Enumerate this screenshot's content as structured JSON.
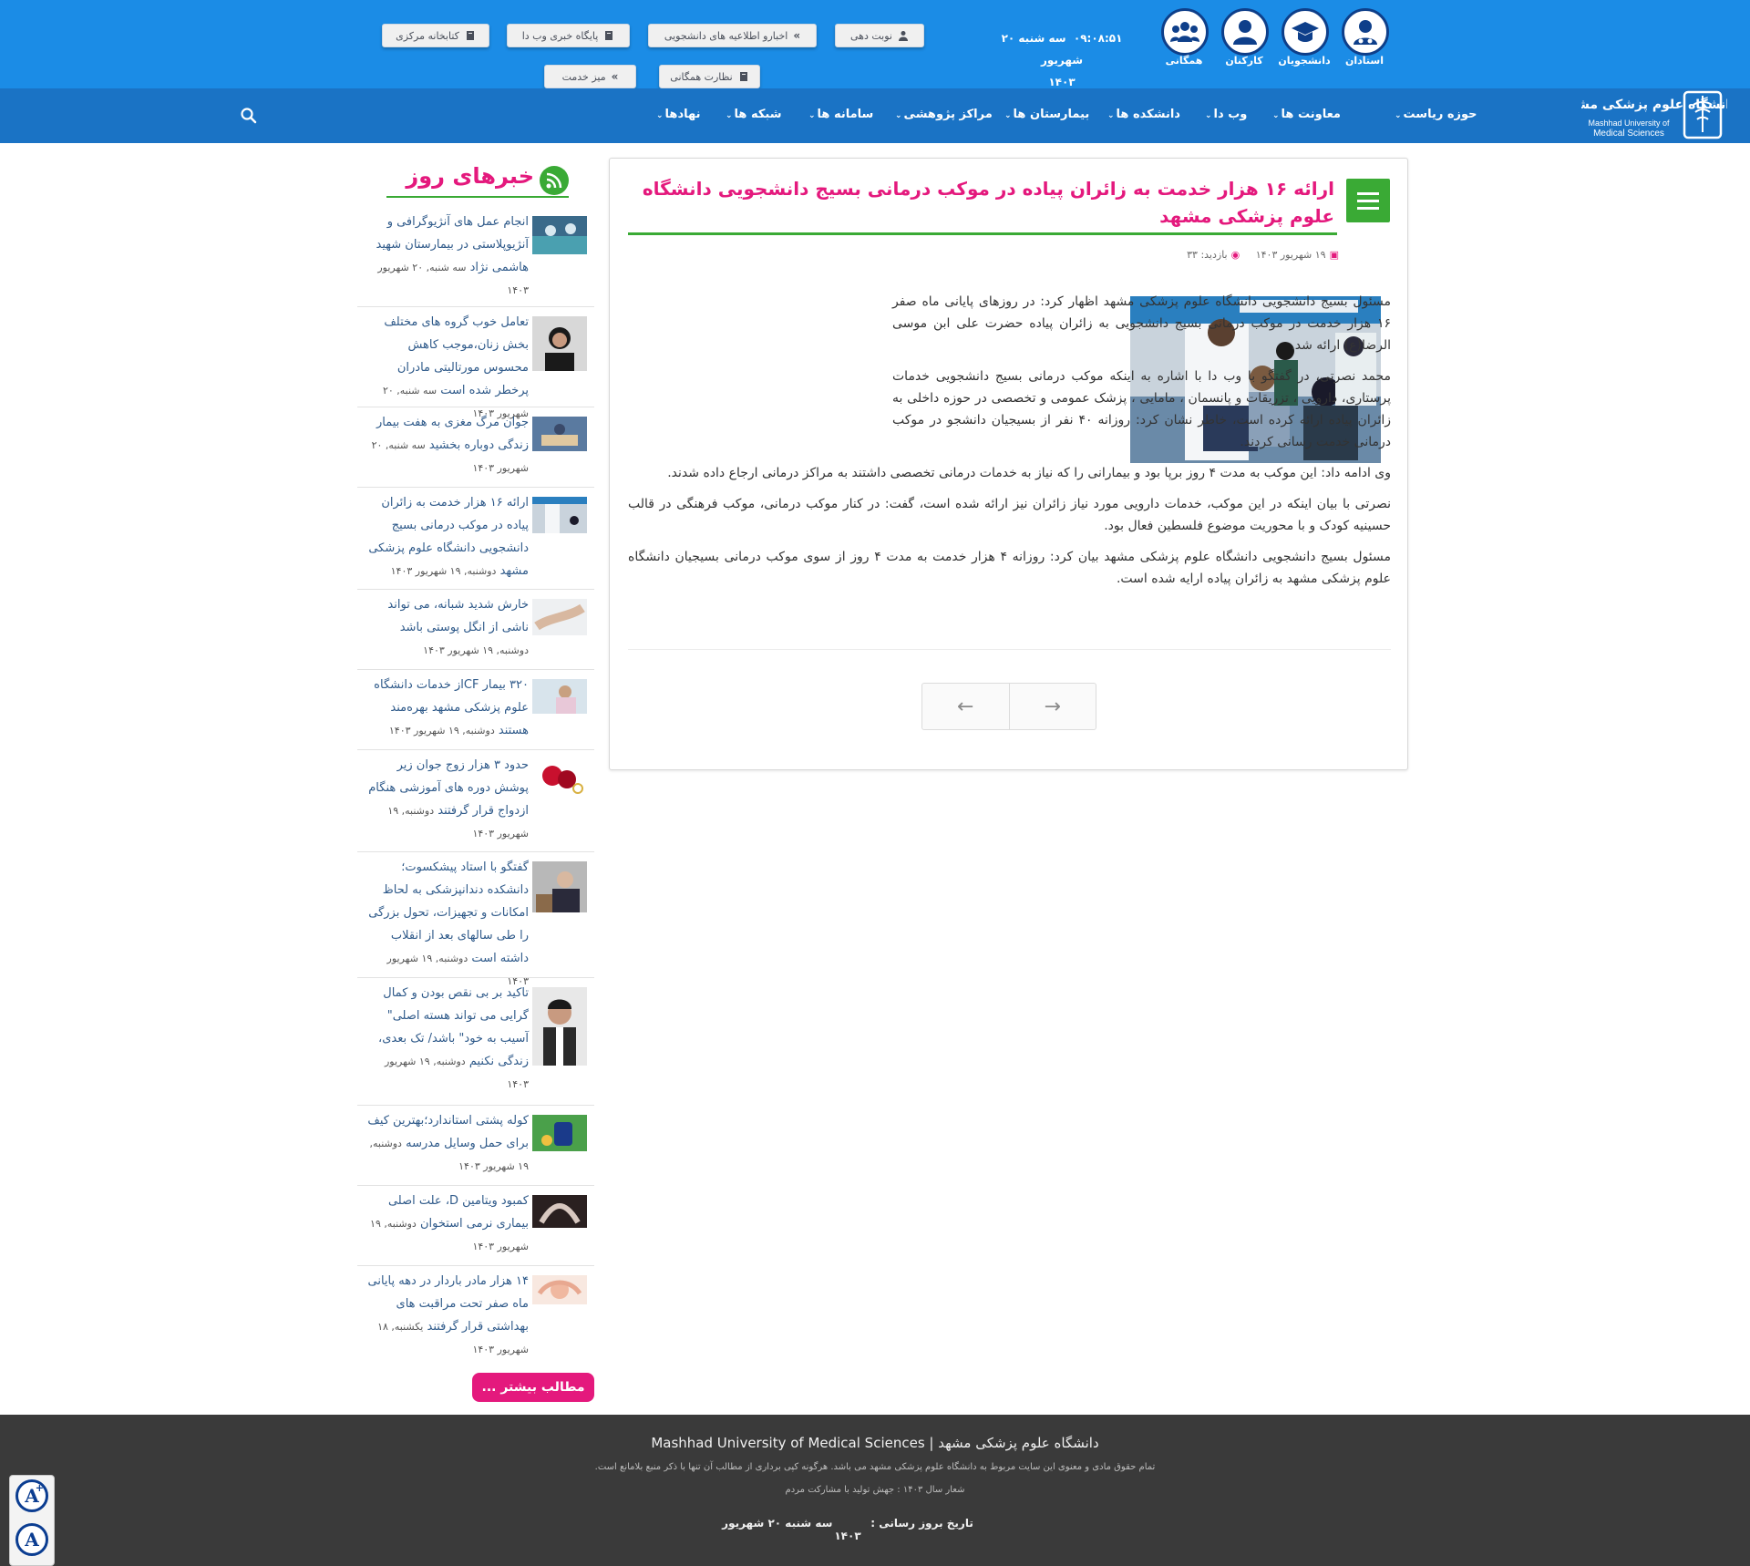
{
  "topbar": {
    "audiences": [
      {
        "label": "استادان",
        "icon": "professor-icon"
      },
      {
        "label": "دانشجویان",
        "icon": "student-icon"
      },
      {
        "label": "کارکنان",
        "icon": "staff-icon"
      },
      {
        "label": "همگانی",
        "icon": "public-icon"
      }
    ],
    "clock": "۰۹:۰۸:۵۱",
    "date_line1": "سه شنبه ۲۰ شهریور",
    "date_line2": "۱۴۰۳",
    "buttons": {
      "appointment": "نوبت دهی",
      "student_news": "اخبارو اطلاعیه های دانشجویی",
      "webda": "پایگاه خبری وب دا",
      "library": "کتابخانه مرکزی",
      "public_oversight": "نظارت همگانی",
      "service_desk": "میز خدمت"
    }
  },
  "nav": {
    "items": [
      "حوزه ریاست",
      "معاونت ها",
      "وب دا",
      "دانشکده ها",
      "بیمارستان ها",
      "مراکز پژوهشی",
      "سامانه ها",
      "شبکه ها",
      "نهادها"
    ],
    "logo_fa": "دانشگاه علوم پزشکی مشهد",
    "logo_en1": "Mashhad University of",
    "logo_en2": "Medical Sciences"
  },
  "article": {
    "title": "ارائه ۱۶ هزار خدمت به زائران پیاده در موکب درمانی بسیج دانشجویی دانشگاه علوم پزشکی مشهد",
    "date": "۱۹ شهریور ۱۴۰۳",
    "views_label": "بازدید: ۳۳",
    "paragraphs": [
      "مسئول بسیج  دانشجویی دانشگاه علوم پزشکی مشهد اظهار کرد: در روزهای پایانی ماه صفر ۱۶ هزار خدمت در موکب درمانی بسیج دانشجویی به زائران پیاده حضرت علی ابن موسی الرضا(ع) ارائه شد.",
      "محمد نصرتی، در گفتگو با وب دا با اشاره به اینکه  موکب درمانی بسیج دانشجویی خدمات پرستاری، دارویی ، تزریقات و پانسمان ، مامایی ، پزشک عمومی و تخصصی در حوزه داخلی به زائران پیاده ارائه کرده است، خاطر نشان کرد: روزانه ۴۰ نفر از بسیجیان دانشجو در موکب درمانی خدمت رسانی کردند.",
      "وی ادامه داد: این موکب به مدت ۴ روز برپا بود و بیمارانی را که نیاز به خدمات درمانی تخصصی داشتند به مراکز درمانی ارجاع داده شدند.",
      "نصرتی با بیان اینکه در این موکب، خدمات دارویی مورد نیاز زائران نیز ارائه شده است، گفت: در کنار موکب درمانی، موکب فرهنگی در قالب حسینیه کودک و با محوریت موضوع فلسطین فعال بود.",
      "مسئول بسیج دانشجویی دانشگاه علوم پزشکی مشهد بیان کرد: روزانه ۴ هزار خدمت به مدت ۴ روز از سوی موکب درمانی بسیجیان دانشگاه علوم پزشکی مشهد به زائران پیاده ارایه شده است."
    ]
  },
  "sidebar": {
    "title": "خبرهای روز",
    "more": "مطالب بیشتر ...",
    "news": [
      {
        "title": "انجام عمل های آنژیوگرافی و آنژیوپلاستی در بیمارستان شهید هاشمی نژاد",
        "date": "سه شنبه, ۲۰ شهریور ۱۴۰۳"
      },
      {
        "title": "تعامل خوب گروه های مختلف بخش زنان،موجب کاهش محسوس مورتالیتی مادران پرخطر شده است",
        "date": "سه شنبه, ۲۰ شهریور ۱۴۰۳"
      },
      {
        "title": "جوان مرگ مغزی به هفت بیمار زندگی دوباره بخشید",
        "date": "سه شنبه, ۲۰ شهریور ۱۴۰۳"
      },
      {
        "title": "ارائه ۱۶ هزار خدمت به زائران پیاده در موکب درمانی بسیج دانشجویی دانشگاه علوم پزشکی مشهد",
        "date": "دوشنبه, ۱۹ شهریور ۱۴۰۳"
      },
      {
        "title": "خارش شدید شبانه، می تواند ناشی از انگل پوستی باشد",
        "date": "دوشنبه, ۱۹ شهریور ۱۴۰۳"
      },
      {
        "title": "۳۲۰ بیمار CFاز خدمات دانشگاه علوم پزشکی مشهد بهره‌مند هستند",
        "date": "دوشنبه, ۱۹ شهریور ۱۴۰۳"
      },
      {
        "title": "حدود ۳ هزار زوج جوان زیر پوشش دوره های آموزشی هنگام ازدواج قرار گرفتند",
        "date": "دوشنبه, ۱۹ شهریور ۱۴۰۳"
      },
      {
        "title": "گفتگو با استاد پیشکسوت؛ دانشکده دندانپزشکی به لحاظ امکانات و تجهیزات، تحول بزرگی را طی سالهای بعد از انقلاب داشته است",
        "date": "دوشنبه, ۱۹ شهریور ۱۴۰۳"
      },
      {
        "title": "تاکید بر بی نقص بودن و کمال گرایی می تواند هسته اصلی\" آسیب به خود\" باشد/ تک بعدی، زندگی نکنیم",
        "date": "دوشنبه, ۱۹ شهریور ۱۴۰۳"
      },
      {
        "title": "کوله پشتی استاندارد؛بهترین کیف برای حمل وسایل مدرسه",
        "date": "دوشنبه, ۱۹ شهریور ۱۴۰۳"
      },
      {
        "title": "کمبود ویتامین D، علت اصلی بیماری نرمی استخوان",
        "date": "دوشنبه, ۱۹ شهریور ۱۴۰۳"
      },
      {
        "title": "۱۴ هزار مادر باردار در دهه پایانی ماه صفر تحت مراقبت های بهداشتی قرار گرفتند",
        "date": "یکشنبه, ۱۸ شهریور ۱۴۰۳"
      }
    ]
  },
  "footer": {
    "name": "دانشگاه علوم پزشکی مشهد | Mashhad University of Medical Sciences",
    "rights": "تمام حقوق مادی و معنوی این سایت مربوط به دانشگاه علوم پزشکی مشهد می باشد. هرگونه کپی برداری از مطالب آن تنها با ذکر منبع بلامانع است.",
    "slogan": "شعار سال ۱۴۰۳ : جهش تولید با مشارکت مردم",
    "update_label": "تاریخ بروز رسانی :",
    "update_date": "سه شنبه ۲۰ شهریور ۱۴۰۳"
  },
  "accessibility": {
    "increase": "A",
    "decrease": "A"
  },
  "colors": {
    "topbar": "#1b8ce6",
    "navbar": "#1a73c5",
    "accent_pink": "#e4197d",
    "accent_green": "#3aaa35",
    "footer": "#3a3a3a"
  }
}
